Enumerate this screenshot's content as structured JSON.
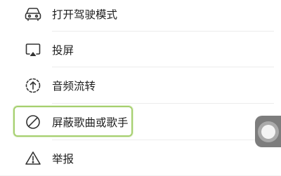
{
  "menu": {
    "items": [
      {
        "label": "打开驾驶模式",
        "icon": "car-icon"
      },
      {
        "label": "投屏",
        "icon": "airplay-icon"
      },
      {
        "label": "音频流转",
        "icon": "audio-transfer-icon"
      },
      {
        "label": "屏蔽歌曲或歌手",
        "icon": "block-icon"
      },
      {
        "label": "举报",
        "icon": "warning-icon"
      }
    ]
  },
  "colors": {
    "highlight": "#a6d06f",
    "text": "#1e1e1e",
    "divider": "#ececec"
  }
}
